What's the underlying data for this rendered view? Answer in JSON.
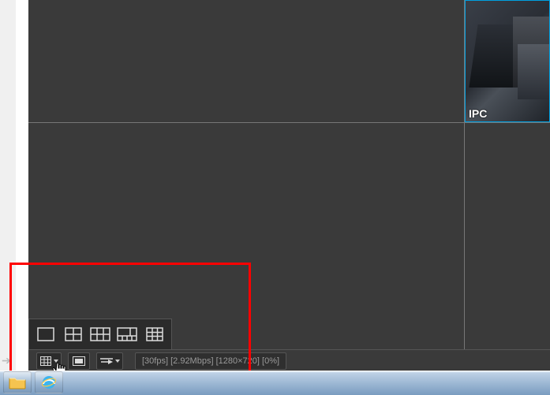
{
  "camera": {
    "label": "IPC"
  },
  "toolbar": {
    "split_more_title": "View split",
    "fullscreen_title": "Fullscreen",
    "ratio_title": "Display ratio"
  },
  "split_options": {
    "opt1_title": "1 view",
    "opt2_title": "4 views",
    "opt3_title": "6 views",
    "opt4_title": "8 views",
    "opt5_title": "9 views"
  },
  "status": {
    "fps": "[30fps]",
    "bitrate": "[2.92Mbps]",
    "resolution": "[1280×720]",
    "loss": "[0%]"
  },
  "taskbar": {
    "browser_title": "Internet Explorer",
    "explorer_title": "Windows Explorer"
  }
}
